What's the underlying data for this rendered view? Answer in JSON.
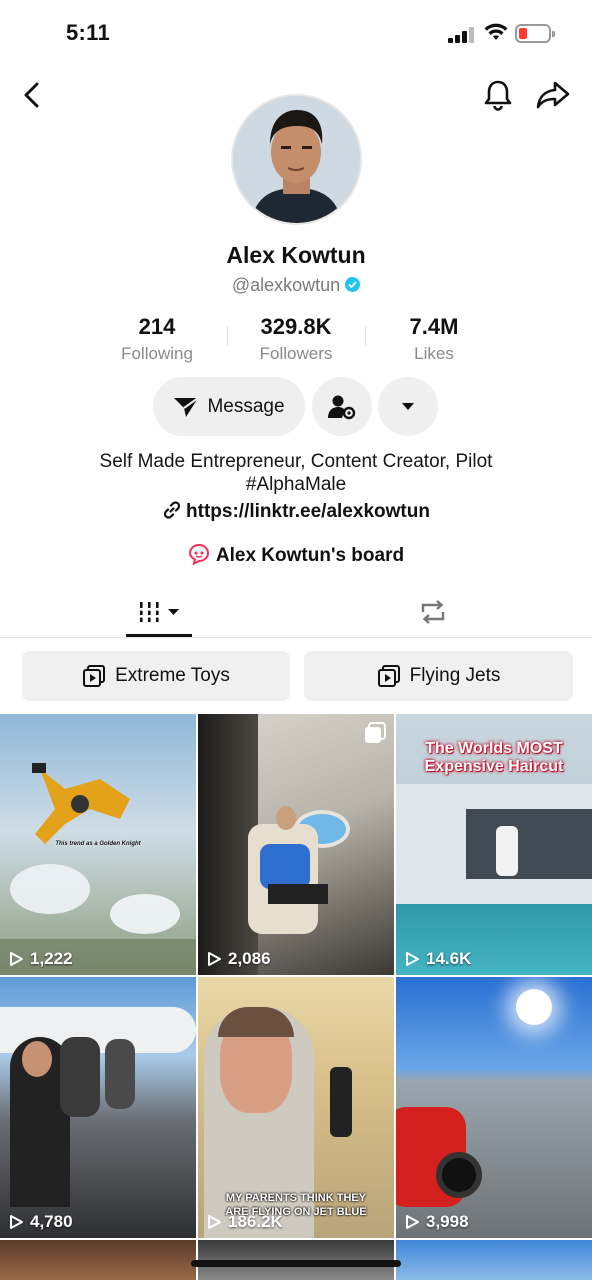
{
  "status": {
    "time": "5:11"
  },
  "profile": {
    "name": "Alex Kowtun",
    "handle": "@alexkowtun",
    "stats": [
      {
        "value": "214",
        "label": "Following"
      },
      {
        "value": "329.8K",
        "label": "Followers"
      },
      {
        "value": "7.4M",
        "label": "Likes"
      }
    ],
    "message_label": "Message",
    "bio_line1": "Self Made Entrepreneur, Content Creator, Pilot",
    "bio_line2": "#AlphaMale",
    "link": "https://linktr.ee/alexkowtun",
    "board": "Alex Kowtun's board"
  },
  "playlists": [
    {
      "label": "Extreme Toys"
    },
    {
      "label": "Flying Jets"
    }
  ],
  "videos": [
    {
      "views": "1,222",
      "caption": "This trend as a Golden Knight",
      "icon": "play-icon"
    },
    {
      "views": "2,086",
      "caption": "",
      "icon": "play-icon"
    },
    {
      "views": "14.6K",
      "caption": "The Worlds MOST Expensive Haircut",
      "icon": "play-icon"
    },
    {
      "views": "4,780",
      "caption": "",
      "icon": "play-icon"
    },
    {
      "views": "186.2K",
      "caption": "MY PARENTS THINK THEY ARE FLYING ON JET BLUE",
      "icon": "play-icon"
    },
    {
      "views": "3,998",
      "caption": "",
      "icon": "play-icon"
    }
  ],
  "colors": {
    "verified": "#20c4f4",
    "battery_low": "#ff3b30",
    "board_icon": "#fe2c55"
  }
}
